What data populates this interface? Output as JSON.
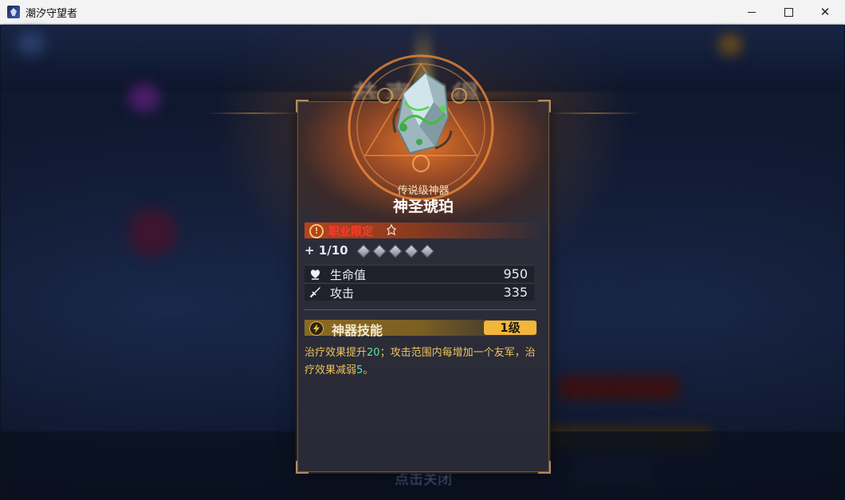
{
  "window": {
    "title": "潮汐守望者",
    "controls": {
      "minimize": "minimize",
      "maximize": "maximize",
      "close": "close"
    }
  },
  "scene": {
    "banner_title": "恭喜获得",
    "tap_to_close": "点击关闭"
  },
  "item": {
    "rarity": "传说级神器",
    "name": "神圣琥珀",
    "restriction_label": "职业限定",
    "enhance_level": "+ 1/10",
    "enhance_slots_total": 5,
    "stats": [
      {
        "label": "生命值",
        "value": "950",
        "icon": "heart-icon"
      },
      {
        "label": "攻击",
        "value": "335",
        "icon": "sword-icon"
      }
    ],
    "skill": {
      "title": "神器技能",
      "level": "1级",
      "desc_part1": "治疗效果提升",
      "desc_val1": "20",
      "desc_part2": "；攻击范围内每增加一个友军，治疗效果减弱",
      "desc_val2": "5",
      "desc_part3": "。"
    }
  },
  "colors": {
    "rarity_glow": "#e87a2a",
    "restriction_red": "#ff3a2a",
    "skill_gold": "#f2b63a",
    "desc_text": "#f0c35a",
    "highlight_green": "#5fe0a0"
  }
}
